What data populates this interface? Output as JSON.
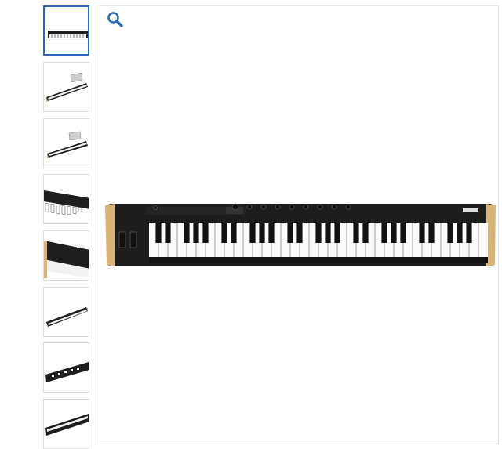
{
  "gallery": {
    "thumbnails": [
      {
        "view": "front-top",
        "selected": true
      },
      {
        "view": "angle-left-with-stand",
        "selected": false
      },
      {
        "view": "angle-left-with-stand-2",
        "selected": false
      },
      {
        "view": "keys-closeup",
        "selected": false
      },
      {
        "view": "side-panel-closeup",
        "selected": false
      },
      {
        "view": "angle-right",
        "selected": false
      },
      {
        "view": "rear-panel-angle",
        "selected": false
      },
      {
        "view": "rear-angle-partial",
        "selected": false
      }
    ],
    "zoom_icon": "magnifier-icon",
    "main_image": {
      "subject": "keyboard-controller",
      "white_keys": 36
    }
  },
  "colors": {
    "accent": "#2a6ab5",
    "body": "#1d1d1d",
    "wood": "#d8b47a"
  }
}
